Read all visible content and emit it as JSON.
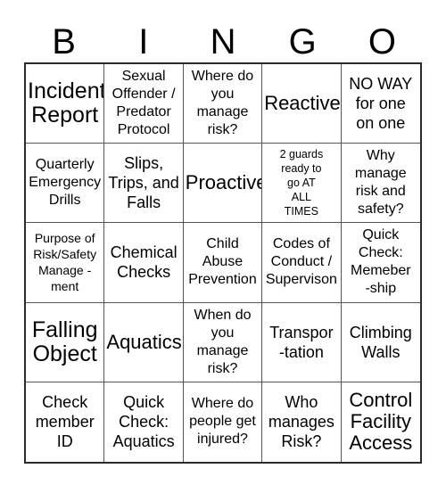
{
  "card": {
    "title": "BINGO",
    "columns": [
      "B",
      "I",
      "N",
      "G",
      "O"
    ],
    "grid_size": "5x5",
    "colors": {
      "background": "#ffffff",
      "text": "#000000",
      "outer_border": "#2b2b2b",
      "inner_border": "#555555"
    },
    "cells": [
      {
        "text": "Incident\nReport",
        "size": "xl"
      },
      {
        "text": "Sexual\nOffender /\nPredator\nProtocol",
        "size": "sm"
      },
      {
        "text": "Where do\nyou\nmanage\nrisk?",
        "size": "sm"
      },
      {
        "text": "Reactive",
        "size": "lg"
      },
      {
        "text": "NO WAY\nfor one\non one",
        "size": "md"
      },
      {
        "text": "Quarterly\nEmergency\nDrills",
        "size": "sm"
      },
      {
        "text": "Slips,\nTrips, and\nFalls",
        "size": "md"
      },
      {
        "text": "Proactive",
        "size": "lg"
      },
      {
        "text": "2 guards\nready to\ngo AT\nALL\nTIMES",
        "size": "xxs"
      },
      {
        "text": "Why\nmanage\nrisk and\nsafety?",
        "size": "sm"
      },
      {
        "text": "Purpose of\nRisk/Safety\nManage -\nment",
        "size": "xs"
      },
      {
        "text": "Chemical\nChecks",
        "size": "md"
      },
      {
        "text": "Child\nAbuse\nPrevention",
        "size": "sm"
      },
      {
        "text": "Codes of\nConduct /\nSupervison",
        "size": "sm"
      },
      {
        "text": "Quick\nCheck:\nMemeber\n-ship",
        "size": "sm"
      },
      {
        "text": "Falling\nObject",
        "size": "xl"
      },
      {
        "text": "Aquatics",
        "size": "lg"
      },
      {
        "text": "When do\nyou\nmanage\nrisk?",
        "size": "sm"
      },
      {
        "text": "Transpor\n-tation",
        "size": "md"
      },
      {
        "text": "Climbing\nWalls",
        "size": "md"
      },
      {
        "text": "Check\nmember\nID",
        "size": "md"
      },
      {
        "text": "Quick\nCheck:\nAquatics",
        "size": "md"
      },
      {
        "text": "Where do\npeople get\ninjured?",
        "size": "sm"
      },
      {
        "text": "Who\nmanages\nRisk?",
        "size": "md"
      },
      {
        "text": "Control\nFacility\nAccess",
        "size": "lg"
      }
    ]
  }
}
